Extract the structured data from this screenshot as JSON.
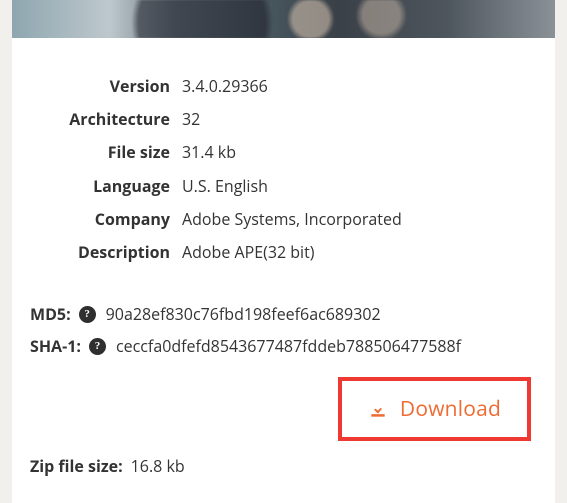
{
  "details": {
    "version": {
      "label": "Version",
      "value": "3.4.0.29366"
    },
    "architecture": {
      "label": "Architecture",
      "value": "32"
    },
    "file_size": {
      "label": "File size",
      "value": "31.4 kb"
    },
    "language": {
      "label": "Language",
      "value": "U.S. English"
    },
    "company": {
      "label": "Company",
      "value": "Adobe Systems, Incorporated"
    },
    "description": {
      "label": "Description",
      "value": "Adobe APE(32 bit)"
    }
  },
  "hashes": {
    "md5": {
      "label": "MD5:",
      "value": "90a28ef830c76fbd198feef6ac689302"
    },
    "sha1": {
      "label": "SHA-1:",
      "value": "ceccfa0dfefd8543677487fddeb788506477588f"
    }
  },
  "download_label": "Download",
  "zip": {
    "label": "Zip file size:",
    "value": "16.8 kb"
  },
  "help_glyph": "?"
}
